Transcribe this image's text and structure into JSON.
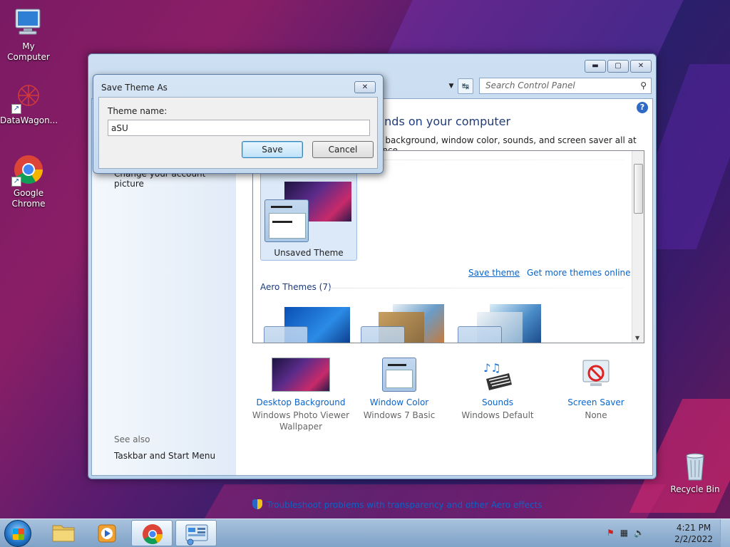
{
  "desktop": {
    "icons": [
      {
        "label": "My Computer"
      },
      {
        "label": "DataWagon..."
      },
      {
        "label": "Google\nChrome"
      },
      {
        "label": "Recycle Bin"
      }
    ]
  },
  "window": {
    "search_placeholder": "Search Control Panel",
    "main_title": "unds on your computer",
    "subtitle": "p background, window color, sounds, and screen saver all at once.",
    "left_links": {
      "account_picture": "Change your account picture",
      "see_also": "See also",
      "taskbar": "Taskbar and Start Menu"
    },
    "themes": {
      "unsaved_label": "Unsaved Theme",
      "save_theme": "Save theme",
      "get_more": "Get more themes online",
      "aero_header": "Aero Themes (7)"
    },
    "bottom": [
      {
        "title": "Desktop Background",
        "sub": "Windows Photo Viewer\nWallpaper"
      },
      {
        "title": "Window Color",
        "sub": "Windows 7 Basic"
      },
      {
        "title": "Sounds",
        "sub": "Windows Default"
      },
      {
        "title": "Screen Saver",
        "sub": "None"
      }
    ],
    "troubleshoot": "Troubleshoot problems with transparency and other Aero effects"
  },
  "dialog": {
    "title": "Save Theme As",
    "label": "Theme name:",
    "value": "aSU",
    "save": "Save",
    "cancel": "Cancel"
  },
  "taskbar": {
    "time": "4:21 PM",
    "date": "2/2/2022"
  }
}
